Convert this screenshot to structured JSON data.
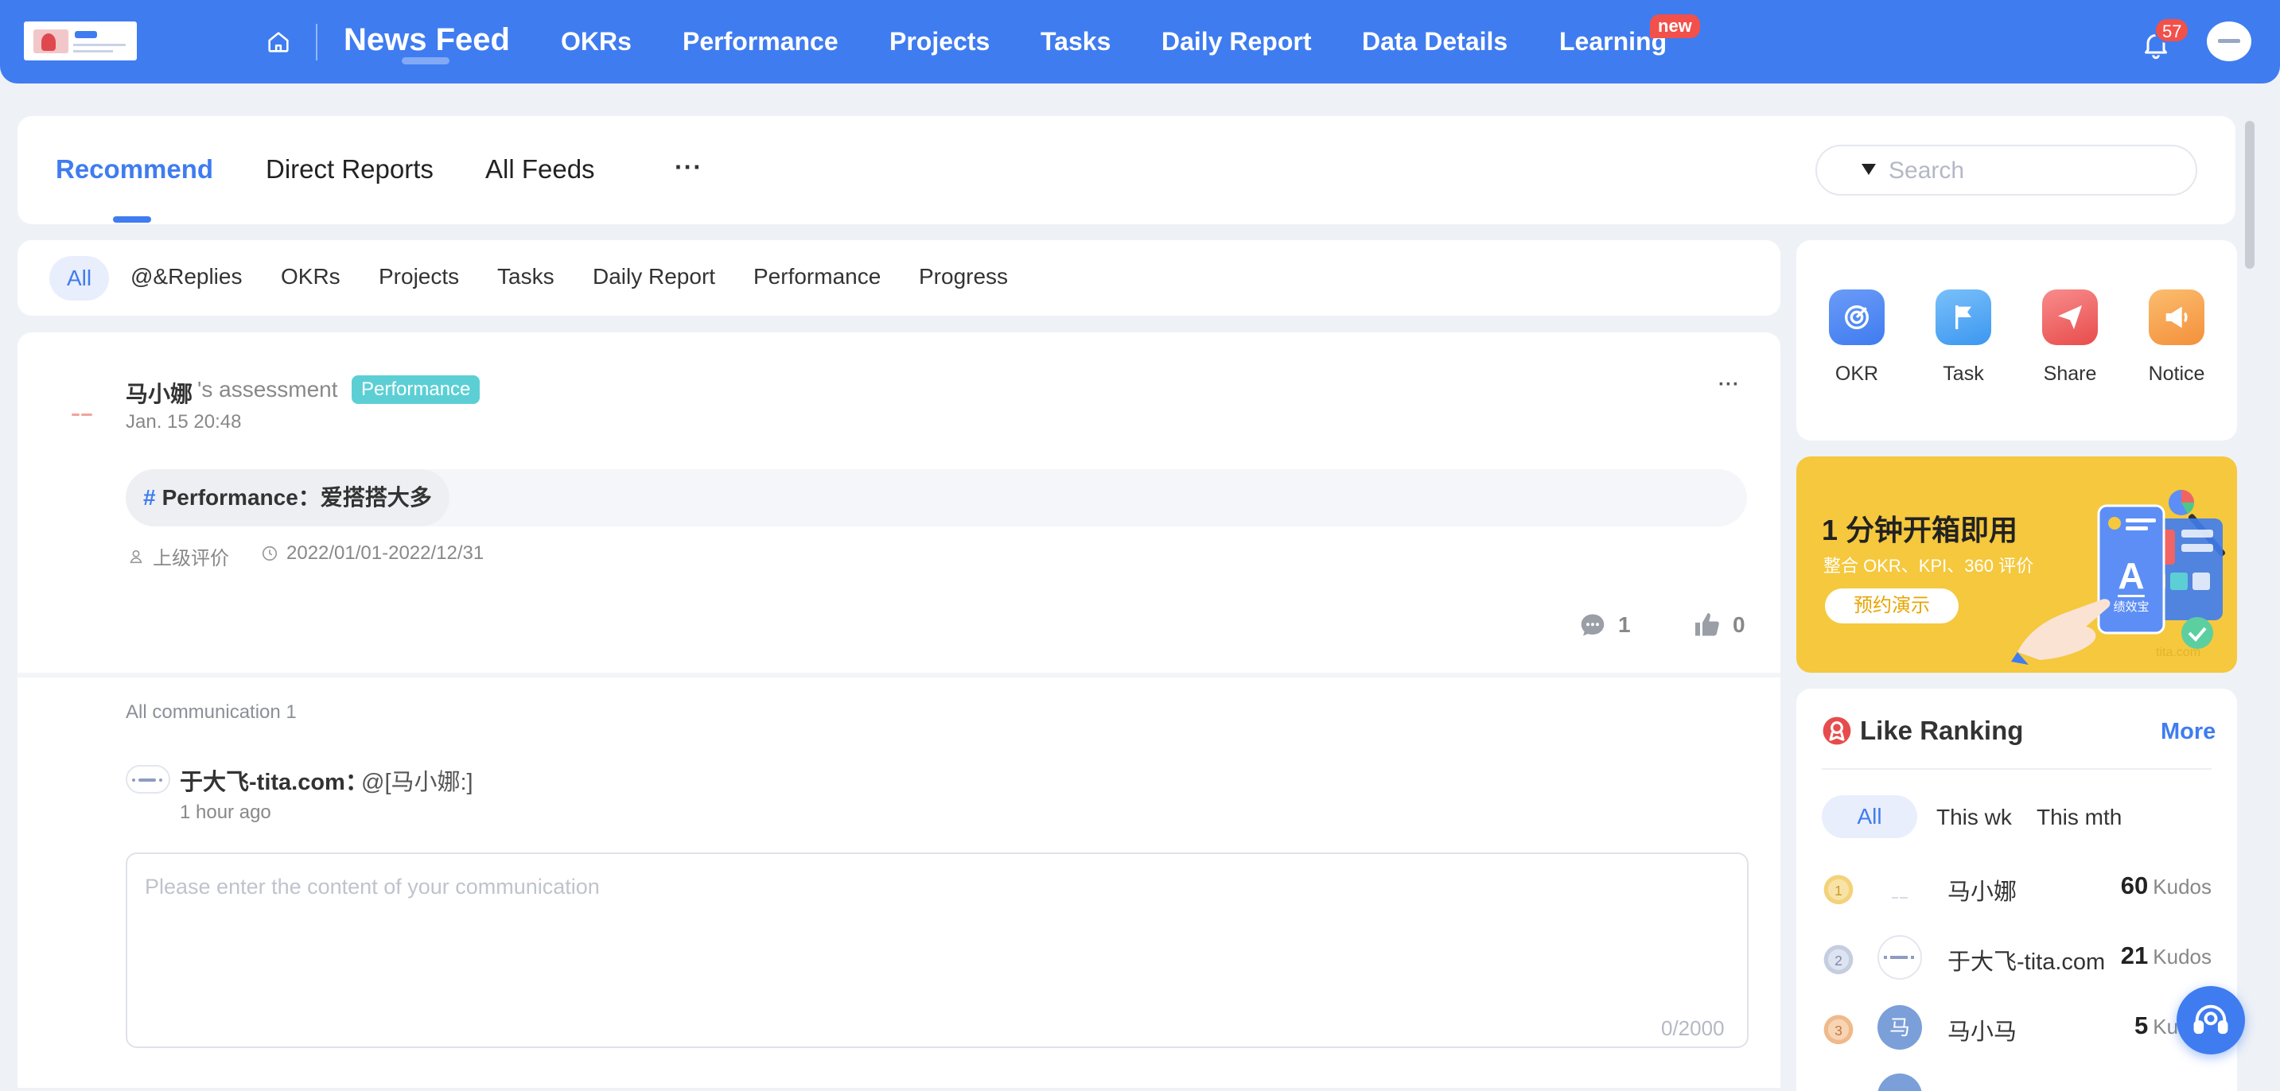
{
  "topnav": {
    "logo_icon": "brand-logo",
    "home_icon": "home-icon",
    "items": [
      {
        "label": "News Feed",
        "active": true
      },
      {
        "label": "OKRs"
      },
      {
        "label": "Performance"
      },
      {
        "label": "Projects"
      },
      {
        "label": "Tasks"
      },
      {
        "label": "Daily Report"
      },
      {
        "label": "Data Details"
      },
      {
        "label": "Learning",
        "badge": "new"
      }
    ],
    "notification_icon": "bell-icon",
    "notification_count": "57",
    "accent_color": "#3f7cf0"
  },
  "tabs": {
    "items": [
      {
        "label": "Recommend",
        "active": true
      },
      {
        "label": "Direct Reports"
      },
      {
        "label": "All Feeds"
      }
    ],
    "more": "···",
    "search_placeholder": "Search"
  },
  "filters": [
    "All",
    "@&Replies",
    "OKRs",
    "Projects",
    "Tasks",
    "Daily Report",
    "Performance",
    "Progress"
  ],
  "post": {
    "author": "马小娜",
    "author_suffix": "'s assessment",
    "tag": "Performance",
    "time": "Jan. 15 20:48",
    "more": "···",
    "topic_hash": "#",
    "topic": "Performance：爱搭搭大多",
    "reviewer": "上级评价",
    "period": "2022/01/01-2022/12/31",
    "comment_count": "1",
    "like_count": "0"
  },
  "communication": {
    "count_label": "All communication 1",
    "comment_author": "于大飞-tita.com：",
    "comment_text": "@[马小娜:]",
    "comment_time": "1 hour ago",
    "input_placeholder": "Please enter the content of your communication",
    "char_count": "0/2000"
  },
  "quick_actions": [
    {
      "label": "OKR",
      "icon": "target-icon",
      "color": "#4d86f5"
    },
    {
      "label": "Task",
      "icon": "flag-icon",
      "color": "#4ba3f5"
    },
    {
      "label": "Share",
      "icon": "paper-plane-icon",
      "color": "#ef5b5b"
    },
    {
      "label": "Notice",
      "icon": "megaphone-icon",
      "color": "#f5a048"
    }
  ],
  "promo": {
    "title": "1 分钟开箱即用",
    "subtitle": "整合 OKR、KPI、360 评价",
    "button": "预约演示",
    "art_label": "绩效宝",
    "brand": "tita.com"
  },
  "ranking": {
    "title": "Like Ranking",
    "more": "More",
    "tabs": [
      {
        "label": "All",
        "active": true
      },
      {
        "label": "This wk"
      },
      {
        "label": "This mth"
      }
    ],
    "unit": "Kudos",
    "rows": [
      {
        "rank": "1",
        "name": "马小娜",
        "score": "60",
        "avatar_text": ""
      },
      {
        "rank": "2",
        "name": "于大飞-tita.com",
        "score": "21",
        "avatar_text": ""
      },
      {
        "rank": "3",
        "name": "马小马",
        "score": "5",
        "avatar_text": "马"
      }
    ]
  }
}
